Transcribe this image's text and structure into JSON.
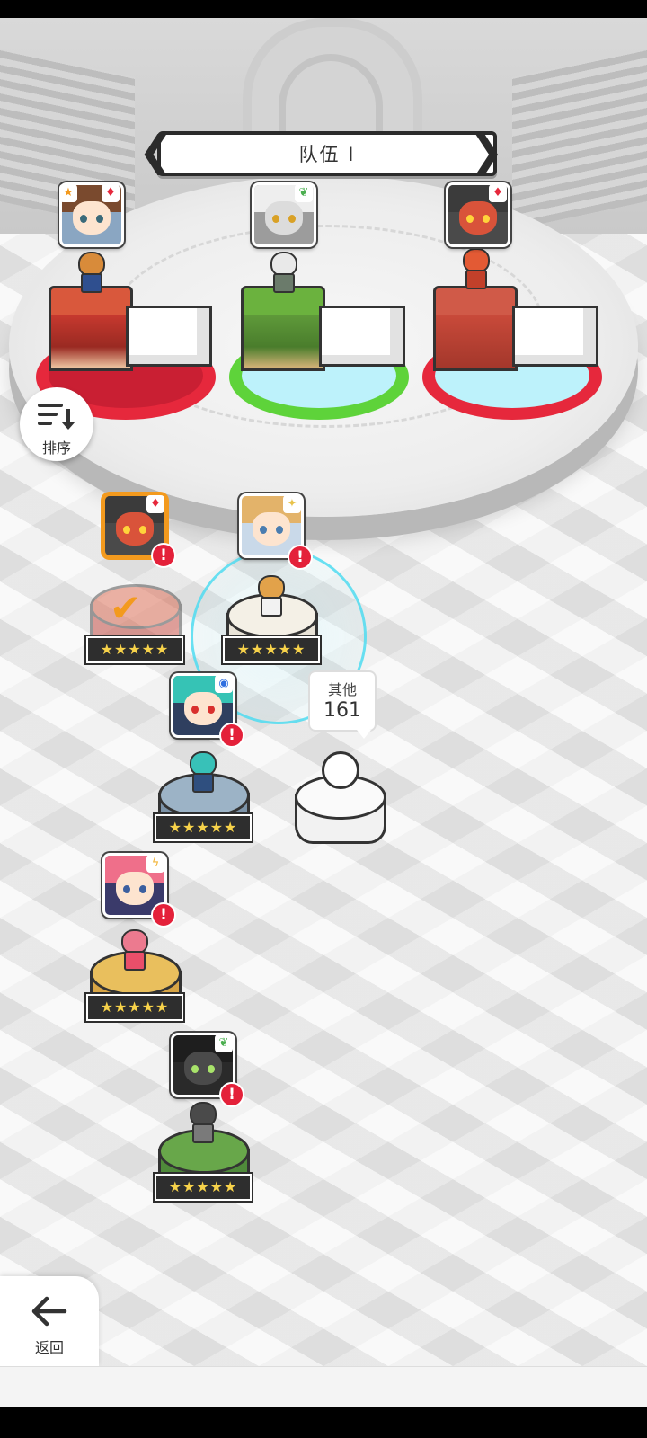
{
  "screen": {
    "title": "队伍 I"
  },
  "team_banner": {
    "title": "队伍 I",
    "prev_icon": "chevron-left-icon",
    "next_icon": "chevron-right-icon"
  },
  "sort_button": {
    "label": "排序",
    "icon": "sort-descending-icon"
  },
  "back_button": {
    "label": "返回",
    "icon": "arrow-left-icon"
  },
  "others_tooltip": {
    "label": "其他",
    "count": "161"
  },
  "team_slots": [
    {
      "slot": 1,
      "character": "brown-haired-boy",
      "type_icon": "heart-icon",
      "leader_icon": "star-icon",
      "ring_color": "#e6283c",
      "pedestal_color": "#c7392f"
    },
    {
      "slot": 2,
      "character": "white-tiger",
      "type_icon": "leaf-icon",
      "ring_color": "#5ed33a",
      "pedestal_color": "#5f9a3a"
    },
    {
      "slot": 3,
      "character": "red-dragon",
      "type_icon": "heart-icon",
      "ring_color": "#e6283c",
      "pedestal_color": "#c94a3a"
    }
  ],
  "roster": [
    {
      "character": "red-dragon",
      "type_icon": "heart-icon",
      "stars": "★★★★★",
      "selected": true,
      "alert": "!"
    },
    {
      "character": "blonde-girl",
      "type_icon": "sparkle-icon",
      "stars": "★★★★★",
      "alert": "!"
    },
    {
      "character": "teal-haired-girl",
      "type_icon": "water-icon",
      "stars": "★★★★★",
      "alert": "!"
    },
    {
      "character": "pink-haired-girl",
      "type_icon": "lightning-icon",
      "stars": "★★★★★",
      "alert": "!"
    },
    {
      "character": "dark-dragon-knight",
      "type_icon": "leaf-icon",
      "stars": "★★★★★",
      "alert": "!"
    }
  ],
  "colors": {
    "accent_alert": "#e4213a",
    "star": "#f7d24a",
    "selection_ring": "#50dcf0",
    "selected_border": "#f39a1e"
  }
}
